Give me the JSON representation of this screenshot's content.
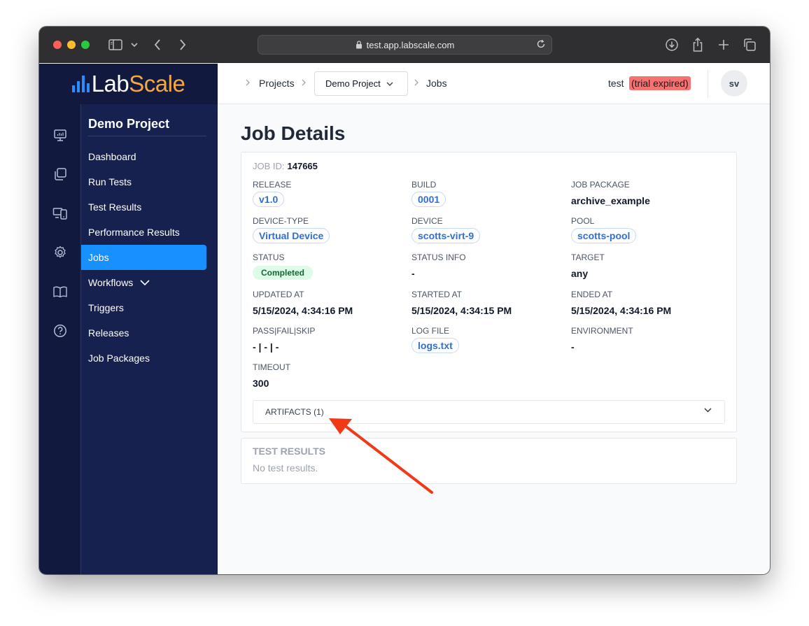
{
  "browser": {
    "url": "test.app.labscale.com",
    "icons": [
      "sidebar-icon",
      "chevron-down-icon",
      "back-icon",
      "forward-icon",
      "lock-icon",
      "reload-icon",
      "download-icon",
      "share-icon",
      "new-tab-icon",
      "tabs-icon"
    ]
  },
  "logo": {
    "part1": "Lab",
    "part2": "Scale"
  },
  "rail": {
    "icons": [
      "monitor-icon",
      "copy-icon",
      "devices-icon",
      "gear-icon",
      "book-icon",
      "help-icon"
    ]
  },
  "sidebar": {
    "project": "Demo Project",
    "items": [
      {
        "label": "Dashboard"
      },
      {
        "label": "Run Tests"
      },
      {
        "label": "Test Results"
      },
      {
        "label": "Performance Results"
      },
      {
        "label": "Jobs"
      },
      {
        "label": "Workflows"
      },
      {
        "label": "Triggers"
      },
      {
        "label": "Releases"
      },
      {
        "label": "Job Packages"
      }
    ]
  },
  "header": {
    "crumb_projects": "Projects",
    "crumb_project_select": "Demo Project",
    "crumb_jobs": "Jobs",
    "user": "test",
    "trial": "(trial expired)",
    "avatar": "sv"
  },
  "page": {
    "title": "Job Details"
  },
  "job": {
    "id_label": "JOB ID:",
    "id_value": "147665",
    "release_label": "RELEASE",
    "release_value": "v1.0",
    "build_label": "BUILD",
    "build_value": "0001",
    "package_label": "JOB PACKAGE",
    "package_value": "archive_example",
    "devtype_label": "DEVICE-TYPE",
    "devtype_value": "Virtual Device",
    "device_label": "DEVICE",
    "device_value": "scotts-virt-9",
    "pool_label": "POOL",
    "pool_value": "scotts-pool",
    "status_label": "STATUS",
    "status_value": "Completed",
    "statusinfo_label": "STATUS INFO",
    "statusinfo_value": "-",
    "target_label": "TARGET",
    "target_value": "any",
    "updated_label": "UPDATED AT",
    "updated_value": "5/15/2024, 4:34:16 PM",
    "started_label": "STARTED AT",
    "started_value": "5/15/2024, 4:34:15 PM",
    "ended_label": "ENDED AT",
    "ended_value": "5/15/2024, 4:34:16 PM",
    "pfs_label": "PASS|FAIL|SKIP",
    "pfs_value": "- | - | -",
    "log_label": "LOG FILE",
    "log_value": "logs.txt",
    "env_label": "ENVIRONMENT",
    "env_value": "-",
    "timeout_label": "TIMEOUT",
    "timeout_value": "300",
    "artifacts_label": "ARTIFACTS (1)"
  },
  "test_results": {
    "title": "TEST RESULTS",
    "empty": "No test results."
  },
  "colors": {
    "sidebar_bg": "#16214f",
    "active_item": "#1890ff",
    "brand_orange": "#f5a742",
    "annotation_arrow": "#f03a17",
    "status_green": "#dcfce7",
    "trial_red": "#f87171"
  }
}
